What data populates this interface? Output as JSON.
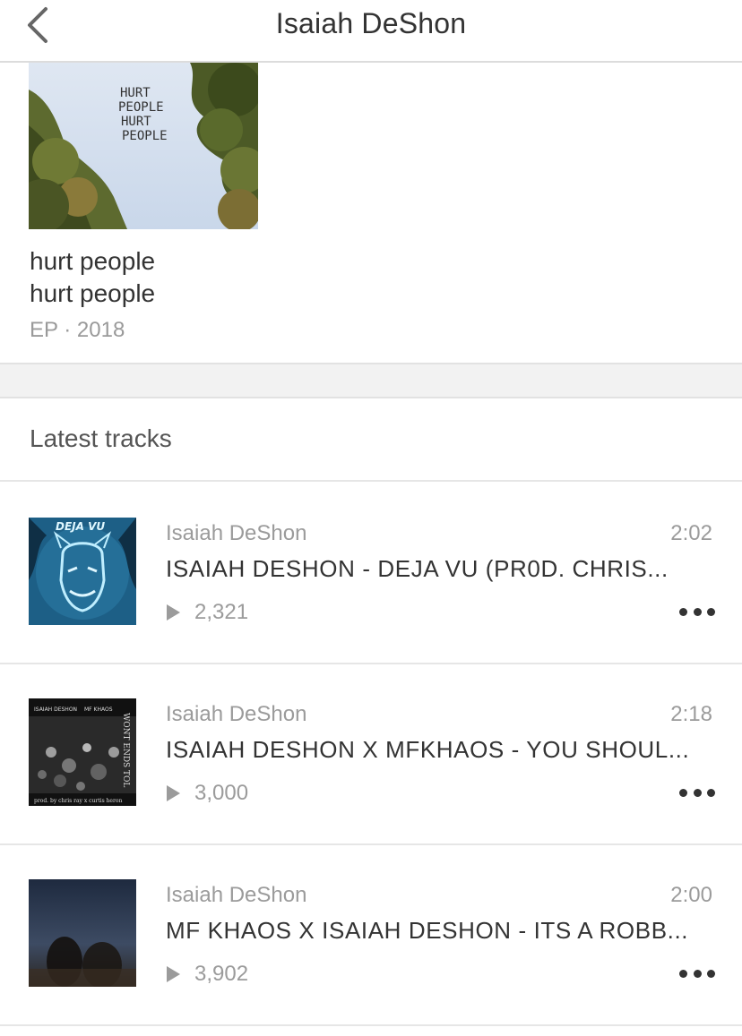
{
  "header": {
    "title": "Isaiah DeShon",
    "back_icon": "chevron-left-icon"
  },
  "album": {
    "art_text": [
      "HURT",
      "PEOPLE",
      "HURT",
      "PEOPLE"
    ],
    "title": "hurt people",
    "subtitle": "hurt people",
    "meta": "EP · 2018"
  },
  "latest": {
    "heading": "Latest tracks",
    "tracks": [
      {
        "artist": "Isaiah DeShon",
        "duration": "2:02",
        "title": "ISAIAH DESHON - DEJA VU (PR0D. CHRIS...",
        "plays": "2,321",
        "art_text": "DEJA VU"
      },
      {
        "artist": "Isaiah DeShon",
        "duration": "2:18",
        "title": "ISAIAH DESHON X MFKHAOS - YOU SHOUL...",
        "plays": "3,000",
        "art_text": [
          "ISAIAH DESHON",
          "MF KHAOS",
          "prod. by chris ray x curtis heron",
          "WONT ENDS TOL"
        ]
      },
      {
        "artist": "Isaiah DeShon",
        "duration": "2:00",
        "title": "MF KHAOS X ISAIAH DESHON - ITS A ROBB...",
        "plays": "3,902"
      }
    ]
  },
  "colors": {
    "text": "#333333",
    "muted": "#9b9b9b",
    "divider": "#e6e6e6",
    "band": "#f2f2f2"
  }
}
